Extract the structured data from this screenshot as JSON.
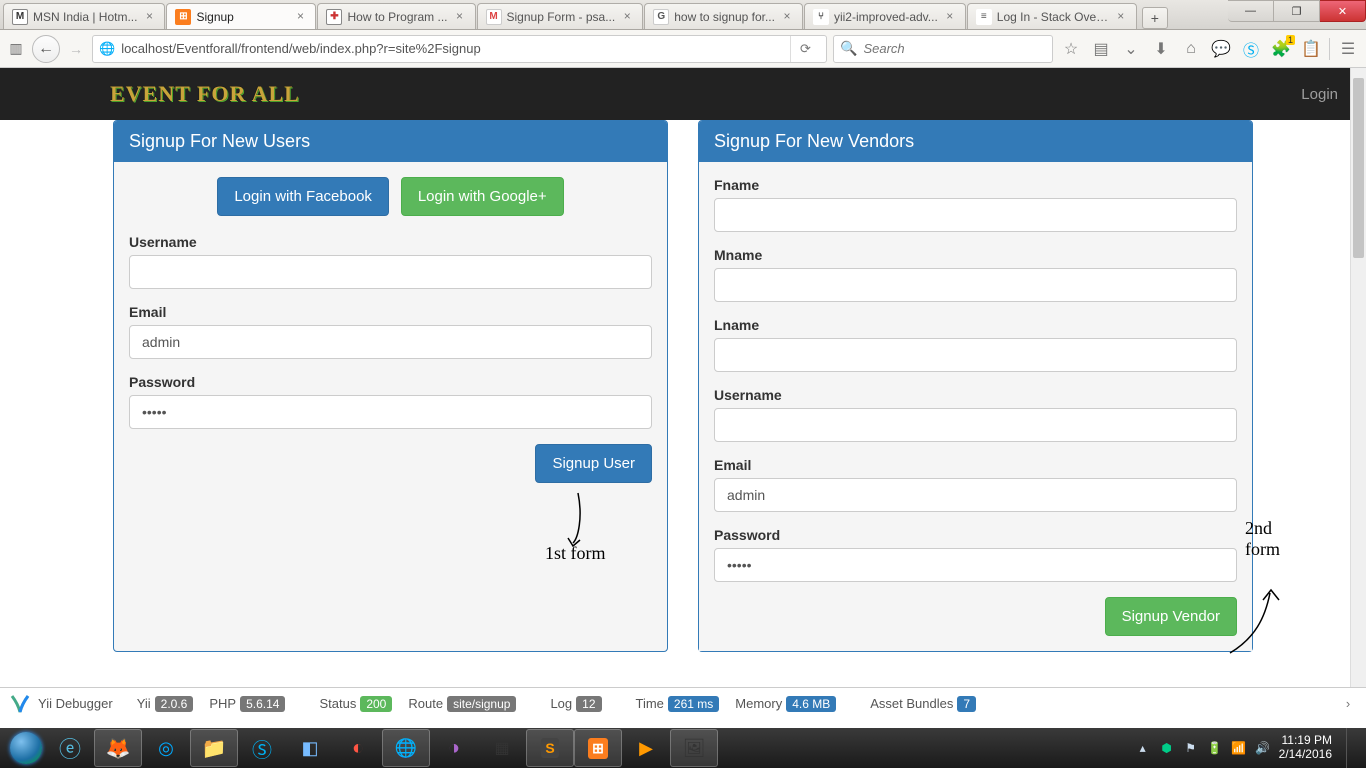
{
  "window": {
    "min": "—",
    "max": "❐",
    "close": "✕"
  },
  "tabs": [
    {
      "label": "MSN India | Hotm...",
      "fav": "M",
      "favclass": "fv-msn"
    },
    {
      "label": "Signup",
      "fav": "⊞",
      "favclass": "fv-xampp",
      "active": true
    },
    {
      "label": "How to Program ...",
      "fav": "✚",
      "favclass": "fv-prog"
    },
    {
      "label": "Signup Form - psa...",
      "fav": "M",
      "favclass": "fv-gmail"
    },
    {
      "label": "how to signup for...",
      "fav": "G",
      "favclass": "fv-google"
    },
    {
      "label": "yii2-improved-adv...",
      "fav": "⑂",
      "favclass": "fv-yii"
    },
    {
      "label": "Log In - Stack Over...",
      "fav": "≡",
      "favclass": "fv-so"
    }
  ],
  "url": "localhost/Eventforall/frontend/web/index.php?r=site%2Fsignup",
  "search_placeholder": "Search",
  "nav": {
    "brand": "EVENT FOR ALL",
    "login": "Login"
  },
  "user_panel": {
    "title": "Signup For New Users",
    "fb": "Login with Facebook",
    "gp": "Login with Google+",
    "username_label": "Username",
    "username_value": "",
    "email_label": "Email",
    "email_value": "admin",
    "password_label": "Password",
    "password_value": "•••••",
    "submit": "Signup User"
  },
  "vendor_panel": {
    "title": "Signup For New Vendors",
    "fname_label": "Fname",
    "fname_value": "",
    "mname_label": "Mname",
    "mname_value": "",
    "lname_label": "Lname",
    "lname_value": "",
    "username_label": "Username",
    "username_value": "",
    "email_label": "Email",
    "email_value": "admin",
    "password_label": "Password",
    "password_value": "•••••",
    "submit": "Signup Vendor"
  },
  "debug": {
    "name": "Yii Debugger",
    "yii_label": "Yii",
    "yii_ver": "2.0.6",
    "php_label": "PHP",
    "php_ver": "5.6.14",
    "status_label": "Status",
    "status_val": "200",
    "route_label": "Route",
    "route_val": "site/signup",
    "log_label": "Log",
    "log_val": "12",
    "time_label": "Time",
    "time_val": "261 ms",
    "mem_label": "Memory",
    "mem_val": "4.6 MB",
    "assets_label": "Asset Bundles",
    "assets_val": "7"
  },
  "tray": {
    "time": "11:19 PM",
    "date": "2/14/2016",
    "notif": "1"
  },
  "annotations": {
    "left": "1st form",
    "right": "2nd\nform"
  }
}
